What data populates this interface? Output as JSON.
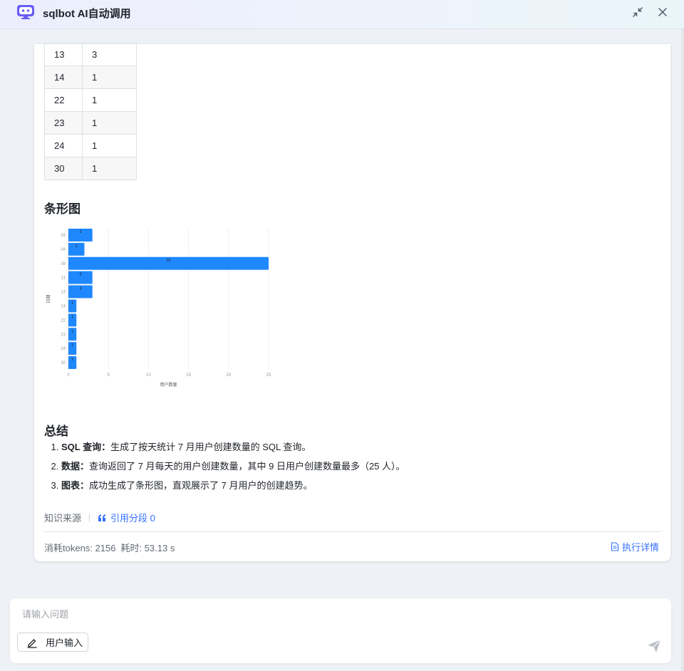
{
  "header": {
    "title": "sqlbot AI自动调用",
    "icons": {
      "logo": "robot-icon",
      "collapse": "minimize-icon",
      "close": "close-icon"
    }
  },
  "table": {
    "rows": [
      [
        "13",
        "3"
      ],
      [
        "14",
        "1"
      ],
      [
        "22",
        "1"
      ],
      [
        "23",
        "1"
      ],
      [
        "24",
        "1"
      ],
      [
        "30",
        "1"
      ]
    ]
  },
  "chart_section_title": "条形图",
  "chart_data": {
    "type": "bar",
    "orientation": "horizontal",
    "categories": [
      "03",
      "04",
      "09",
      "11",
      "13",
      "14",
      "22",
      "23",
      "24",
      "30"
    ],
    "values": [
      3,
      2,
      25,
      3,
      3,
      1,
      1,
      1,
      1,
      1
    ],
    "xlabel": "用户数量",
    "ylabel": "日期",
    "xlim": [
      0,
      25
    ],
    "xticks": [
      0,
      5,
      10,
      15,
      20,
      25
    ],
    "bar_color": "#1f88ff",
    "data_labels": true,
    "grid": "vertical"
  },
  "summary": {
    "title": "总结",
    "items": [
      {
        "label": "SQL 查询",
        "colon": "：",
        "text": "生成了按天统计 7 月用户创建数量的 SQL 查询。"
      },
      {
        "label": "数据",
        "colon": "：",
        "text": "查询返回了 7 月每天的用户创建数量，其中 9 日用户创建数量最多（25 人）。"
      },
      {
        "label": "图表",
        "colon": "：",
        "text": "成功生成了条形图，直观展示了 7 月用户的创建趋势。"
      }
    ]
  },
  "footer": {
    "source_label": "知识来源",
    "citation_label": "引用分段 0",
    "tokens_text": "消耗tokens: 2156",
    "time_text": "耗时: 53.13 s",
    "exec_detail_label": "执行详情"
  },
  "input": {
    "placeholder": "请输入问题",
    "value": "",
    "user_input_label": "用户输入"
  },
  "colors": {
    "accent": "#3370ff",
    "bar": "#1f88ff",
    "logo": "#5a55f6"
  }
}
